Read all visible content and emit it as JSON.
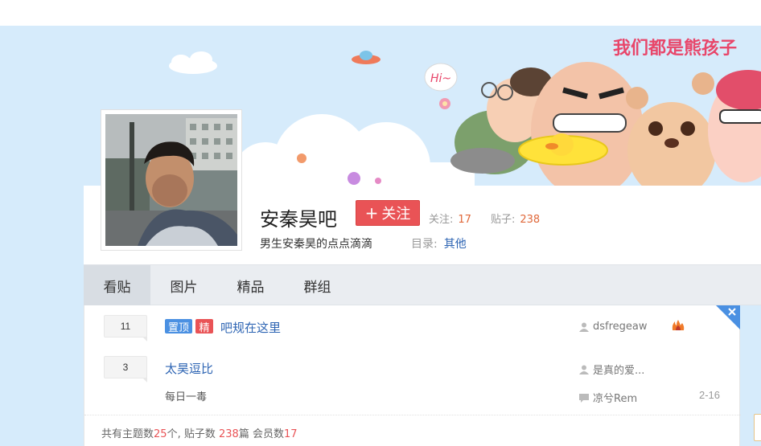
{
  "banner": {
    "slogan_art": "我们都是熊孩子",
    "hi_bubble": "Hi~"
  },
  "forum": {
    "name": "安秦昊吧",
    "follow_label": "关注",
    "follow_icon": "plus-icon",
    "follow_stat_label": "关注:",
    "follow_stat_value": "17",
    "posts_stat_label": "贴子:",
    "posts_stat_value": "238",
    "slogan": "男生安秦昊的点点滴滴",
    "catalog_label": "目录:",
    "catalog_value": "其他"
  },
  "tabs": [
    {
      "label": "看贴",
      "active": true
    },
    {
      "label": "图片",
      "active": false
    },
    {
      "label": "精品",
      "active": false
    },
    {
      "label": "群组",
      "active": false
    }
  ],
  "threads": [
    {
      "replies": "11",
      "badges": [
        "置顶",
        "精"
      ],
      "title": "吧规在这里",
      "author": "dsfregeaw",
      "author_icon": "user-icon",
      "extra_icon": "fire-icon"
    },
    {
      "replies": "3",
      "badges": [],
      "title": "太昊逗比",
      "abstract": "每日一毒",
      "author": "是真的爱...",
      "author_icon": "user-icon",
      "last_reply_by": "凉兮Rem",
      "last_reply_icon": "comment-icon",
      "time": "2-16"
    }
  ],
  "footer": {
    "topics_prefix": "共有主题数",
    "topics_value": "25",
    "topics_unit": "个,",
    "posts_prefix": "贴子数",
    "posts_value": "238",
    "posts_unit": "篇",
    "members_prefix": "会员数",
    "members_value": "17"
  },
  "colors": {
    "banner_bg": "#d6ebfb",
    "follow_red": "#e95356",
    "link_blue": "#2d64b3",
    "stat_orange": "#e0683a",
    "corner_blue": "#4a90e2"
  }
}
